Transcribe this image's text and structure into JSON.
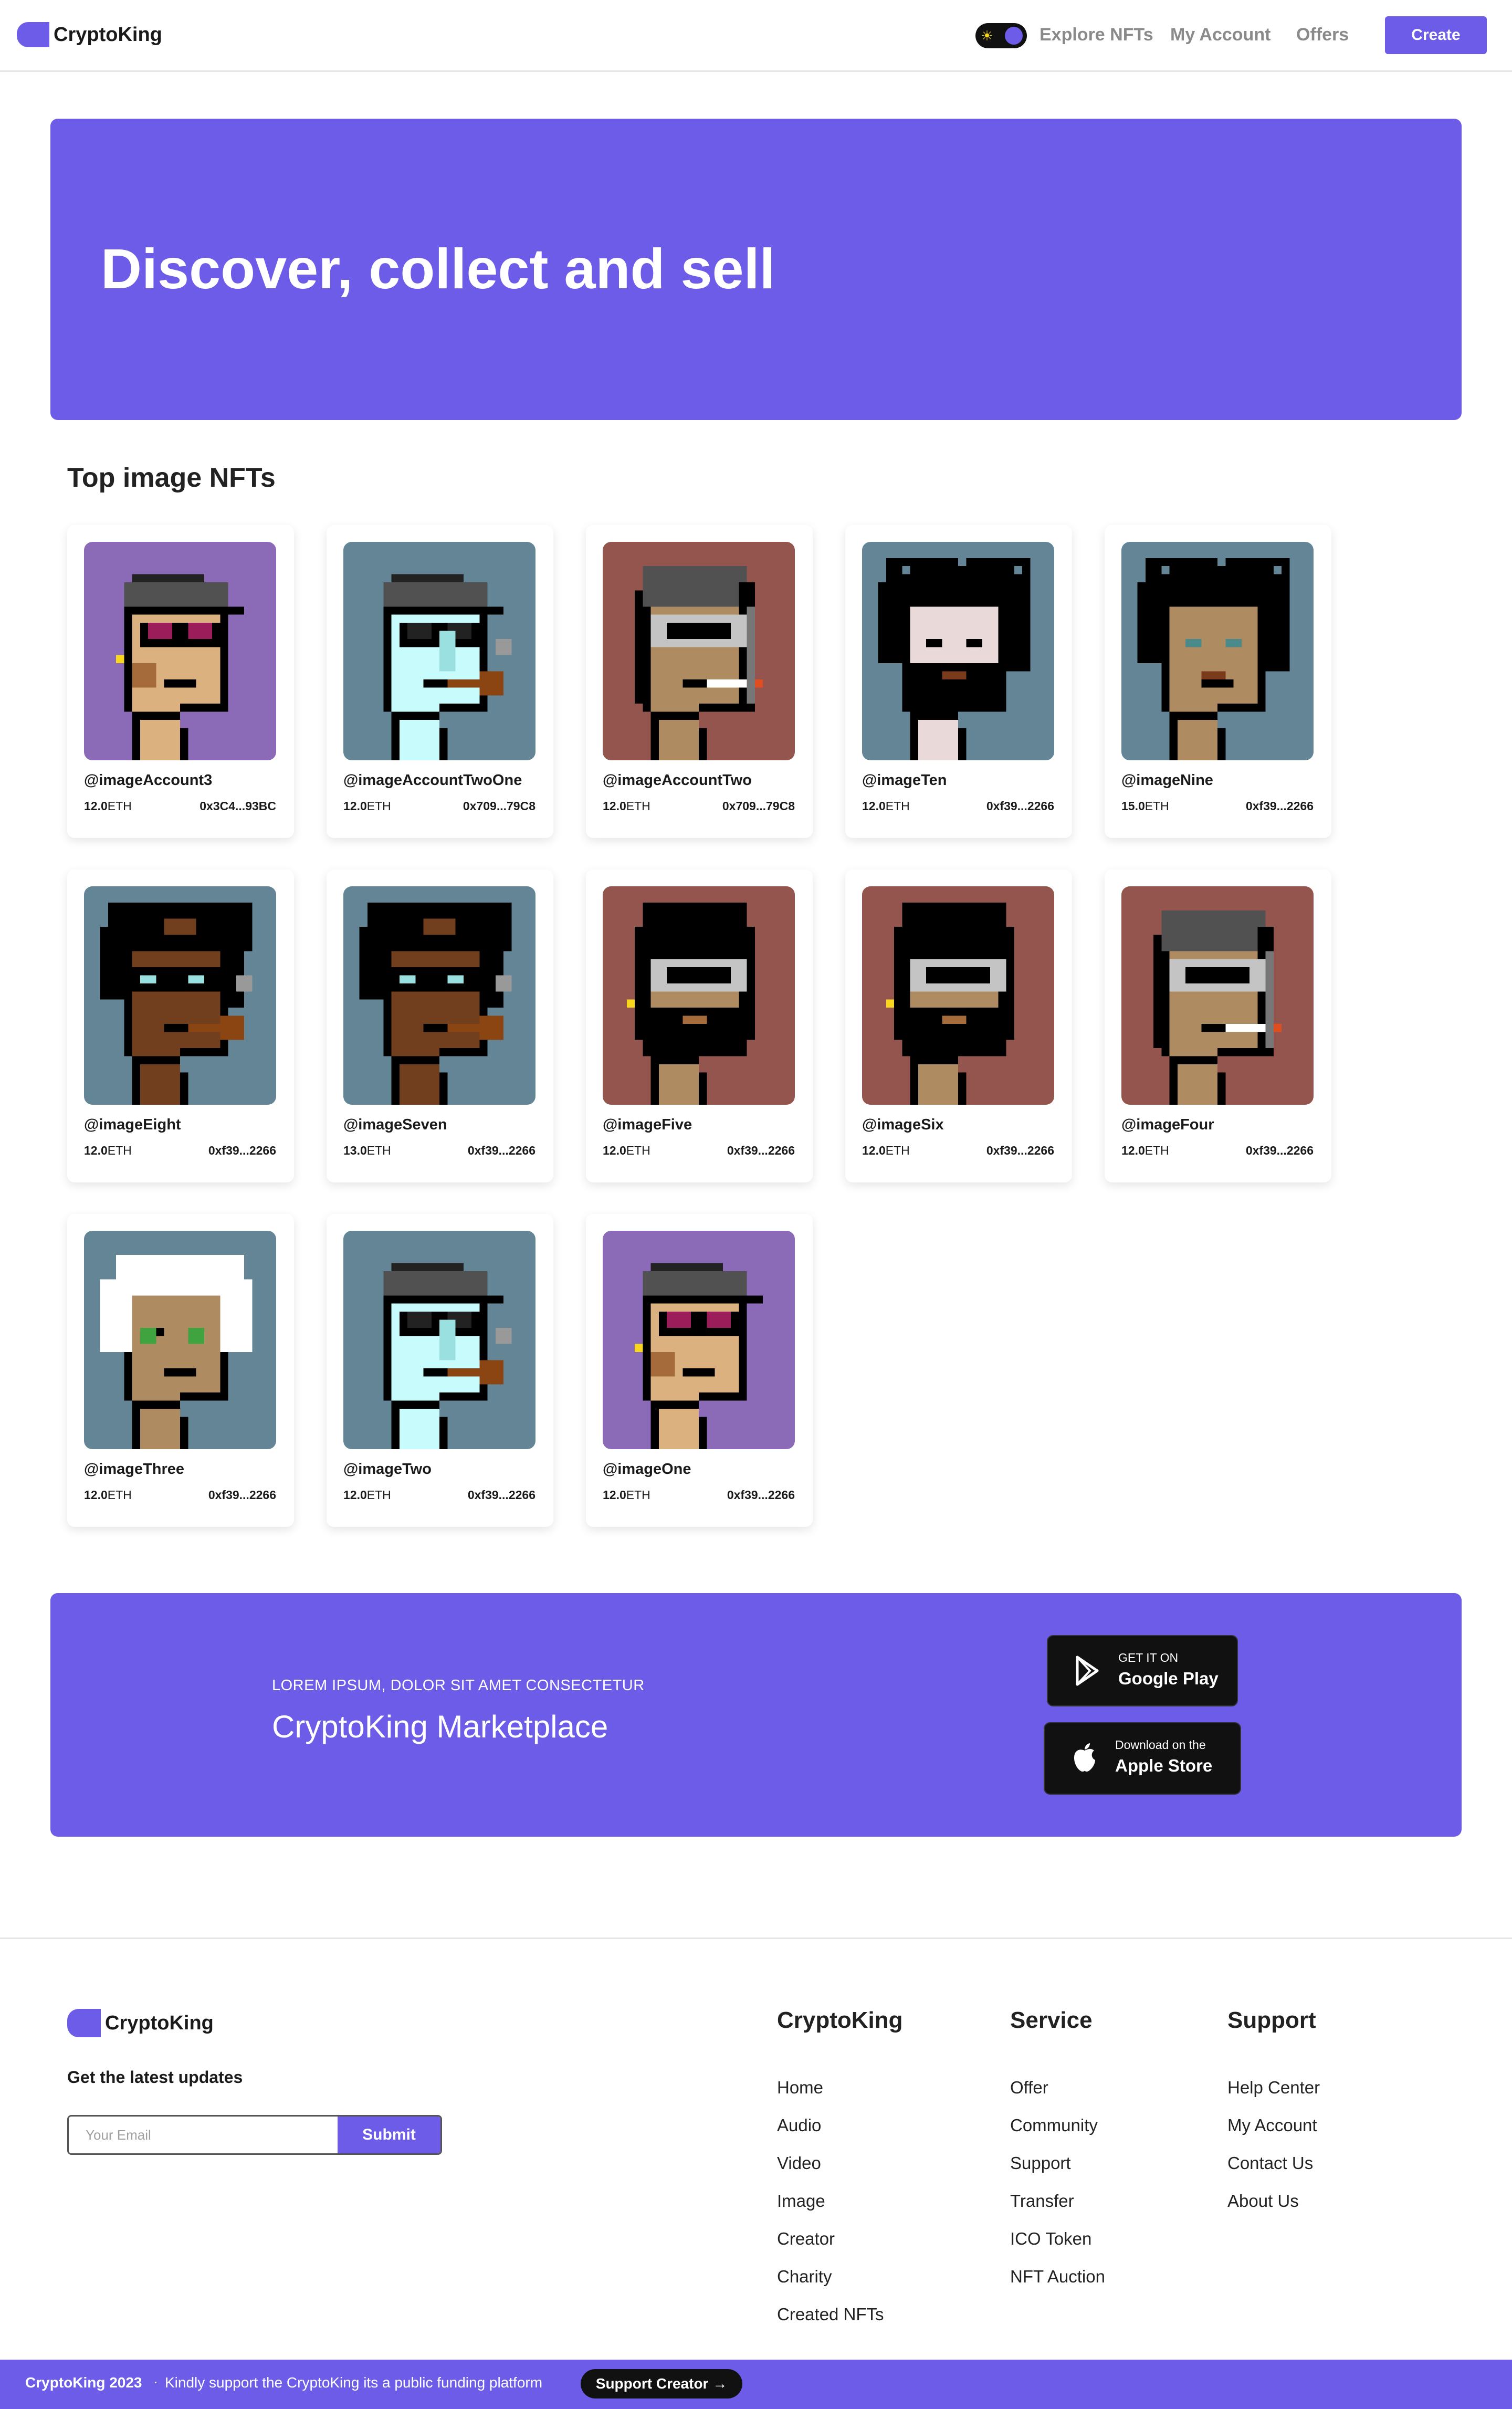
{
  "brand": {
    "name": "CryptoKing"
  },
  "nav": {
    "links": [
      "Explore NFTs",
      "My Account",
      "Offers"
    ],
    "create_label": "Create",
    "theme_toggle": {
      "icon": "sun-icon",
      "state": "dark"
    }
  },
  "hero": {
    "title": "Discover, collect and sell"
  },
  "section": {
    "title": "Top image NFTs"
  },
  "cards": [
    {
      "handle": "@imageAccount3",
      "price": "12.0",
      "unit": "ETH",
      "address": "0x3C4...93BC",
      "bg": "#8b6bb8",
      "skin": "#dbb180",
      "type": "cap-shades"
    },
    {
      "handle": "@imageAccountTwoOne",
      "price": "12.0",
      "unit": "ETH",
      "address": "0x709...79C8",
      "bg": "#638596",
      "skin": "#c8fbfb",
      "type": "alien-cap"
    },
    {
      "handle": "@imageAccountTwo",
      "price": "12.0",
      "unit": "ETH",
      "address": "0x709...79C8",
      "bg": "#95554f",
      "skin": "#ae8b61",
      "type": "helmet-vr"
    },
    {
      "handle": "@imageTen",
      "price": "12.0",
      "unit": "ETH",
      "address": "0xf39...2266",
      "bg": "#638596",
      "skin": "#ead9d9",
      "type": "wild-beard"
    },
    {
      "handle": "@imageNine",
      "price": "15.0",
      "unit": "ETH",
      "address": "0xf39...2266",
      "bg": "#638596",
      "skin": "#ae8b61",
      "type": "wild"
    },
    {
      "handle": "@imageEight",
      "price": "12.0",
      "unit": "ETH",
      "address": "0xf39...2266",
      "bg": "#638596",
      "skin": "#713f1d",
      "type": "wild-pipe"
    },
    {
      "handle": "@imageSeven",
      "price": "13.0",
      "unit": "ETH",
      "address": "0xf39...2266",
      "bg": "#638596",
      "skin": "#713f1d",
      "type": "wild-pipe"
    },
    {
      "handle": "@imageFive",
      "price": "12.0",
      "unit": "ETH",
      "address": "0xf39...2266",
      "bg": "#95554f",
      "skin": "#ae8b61",
      "type": "hood-beard"
    },
    {
      "handle": "@imageSix",
      "price": "12.0",
      "unit": "ETH",
      "address": "0xf39...2266",
      "bg": "#95554f",
      "skin": "#ae8b61",
      "type": "hood-beard"
    },
    {
      "handle": "@imageFour",
      "price": "12.0",
      "unit": "ETH",
      "address": "0xf39...2266",
      "bg": "#95554f",
      "skin": "#ae8b61",
      "type": "helmet-vr"
    },
    {
      "handle": "@imageThree",
      "price": "12.0",
      "unit": "ETH",
      "address": "0xf39...2266",
      "bg": "#638596",
      "skin": "#ae8b61",
      "type": "white-hair"
    },
    {
      "handle": "@imageTwo",
      "price": "12.0",
      "unit": "ETH",
      "address": "0xf39...2266",
      "bg": "#638596",
      "skin": "#c8fbfb",
      "type": "alien-cap"
    },
    {
      "handle": "@imageOne",
      "price": "12.0",
      "unit": "ETH",
      "address": "0xf39...2266",
      "bg": "#8b6bb8",
      "skin": "#dbb180",
      "type": "cap-shades"
    }
  ],
  "promo": {
    "eyebrow": "LOREM IPSUM, DOLOR SIT AMET CONSECTETUR",
    "headline": "CryptoKing Marketplace",
    "google": {
      "small": "GET IT ON",
      "big": "Google Play",
      "icon": "google-play-icon"
    },
    "apple": {
      "small": "Download on the",
      "big": "Apple Store",
      "icon": "apple-icon"
    }
  },
  "footer": {
    "updates_label": "Get the latest updates",
    "email_placeholder": "Your Email",
    "submit_label": "Submit",
    "columns": [
      {
        "title": "CryptoKing",
        "items": [
          "Home",
          "Audio",
          "Video",
          "Image",
          "Creator",
          "Charity",
          "Created NFTs"
        ]
      },
      {
        "title": "Service",
        "items": [
          "Offer",
          "Community",
          "Support",
          "Transfer",
          "ICO Token",
          "NFT Auction"
        ]
      },
      {
        "title": "Support",
        "items": [
          "Help Center",
          "My Account",
          "Contact Us",
          "About Us"
        ]
      }
    ]
  },
  "bottombar": {
    "copyright": "CryptoKing 2023",
    "separator": "·",
    "message": "Kindly support the CryptoKing its a public funding platform",
    "button": "Support Creator →"
  },
  "colors": {
    "accent": "#6c5ce7",
    "dark": "#111111"
  }
}
